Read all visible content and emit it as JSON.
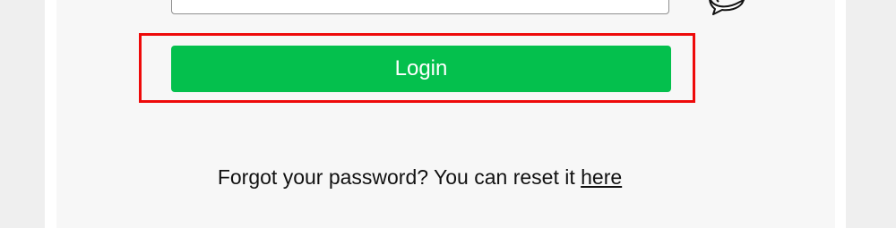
{
  "login_form": {
    "submit_label": "Login"
  },
  "forgot_password": {
    "prompt_text": "Forgot your password? You can reset it",
    "link_text": "here"
  },
  "colors": {
    "login_button": "#04c04d",
    "highlight_border": "#ee0a0a",
    "card_background": "#f7f7f7",
    "page_background": "#efefef"
  },
  "icons": {
    "chat_bubble": "speech-bubble-icon"
  }
}
